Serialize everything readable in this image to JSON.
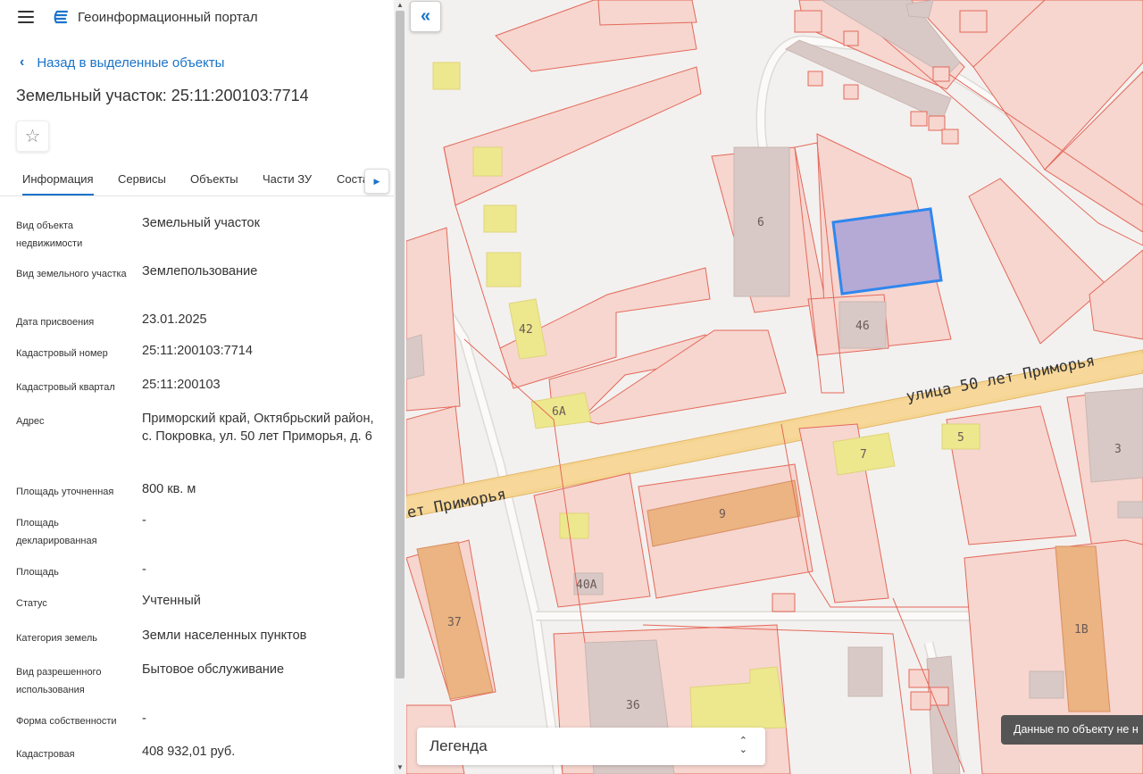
{
  "app": {
    "title": "Геоинформационный портал"
  },
  "nav": {
    "back_label": "Назад в выделенные объекты"
  },
  "object": {
    "title": "Земельный участок: 25:11:200103:7714"
  },
  "tabs": [
    {
      "label": "Информация"
    },
    {
      "label": "Сервисы"
    },
    {
      "label": "Объекты"
    },
    {
      "label": "Части ЗУ"
    },
    {
      "label": "Соста"
    }
  ],
  "properties": [
    {
      "label": "Вид объекта недвижимости",
      "value": "Земельный участок"
    },
    {
      "label": "Вид земельного участка",
      "value": "Землепользование"
    },
    {
      "label": "Дата присвоения",
      "value": "23.01.2025"
    },
    {
      "label": "Кадастровый номер",
      "value": "25:11:200103:7714"
    },
    {
      "label": "Кадастровый квартал",
      "value": "25:11:200103"
    },
    {
      "label": "Адрес",
      "value": "Приморский край, Октябрьский район, с. Покровка, ул. 50 лет Приморья, д. 6"
    },
    {
      "label": "Площадь уточненная",
      "value": "800 кв. м"
    },
    {
      "label": "Площадь декларированная",
      "value": "-"
    },
    {
      "label": "Площадь",
      "value": "-"
    },
    {
      "label": "Статус",
      "value": "Учтенный"
    },
    {
      "label": "Категория земель",
      "value": "Земли населенных пунктов"
    },
    {
      "label": "Вид разрешенного использования",
      "value": "Бытовое обслуживание"
    },
    {
      "label": "Форма собственности",
      "value": "-"
    },
    {
      "label": "Кадастровая",
      "value": "408 932,01 руб."
    }
  ],
  "map": {
    "street_label_main": "улица 50 лет Приморья",
    "street_label_left": "ет Приморья",
    "building_numbers": [
      "6",
      "46",
      "42",
      "6А",
      "7",
      "5",
      "3",
      "9",
      "40А",
      "37",
      "36",
      "1В"
    ],
    "colors": {
      "parcel_fill": "#f6d6cf",
      "parcel_stroke": "#e4685a",
      "road": "#f8d79a",
      "building_grey": "#d9c9c6",
      "building_yellow": "#ede88e",
      "building_orange": "#ebb482",
      "selected_fill": "#b5a9d6",
      "selected_stroke": "#2f87ee"
    }
  },
  "legend": {
    "label": "Легенда"
  },
  "tooltip": {
    "text": "Данные по объекту не н"
  }
}
